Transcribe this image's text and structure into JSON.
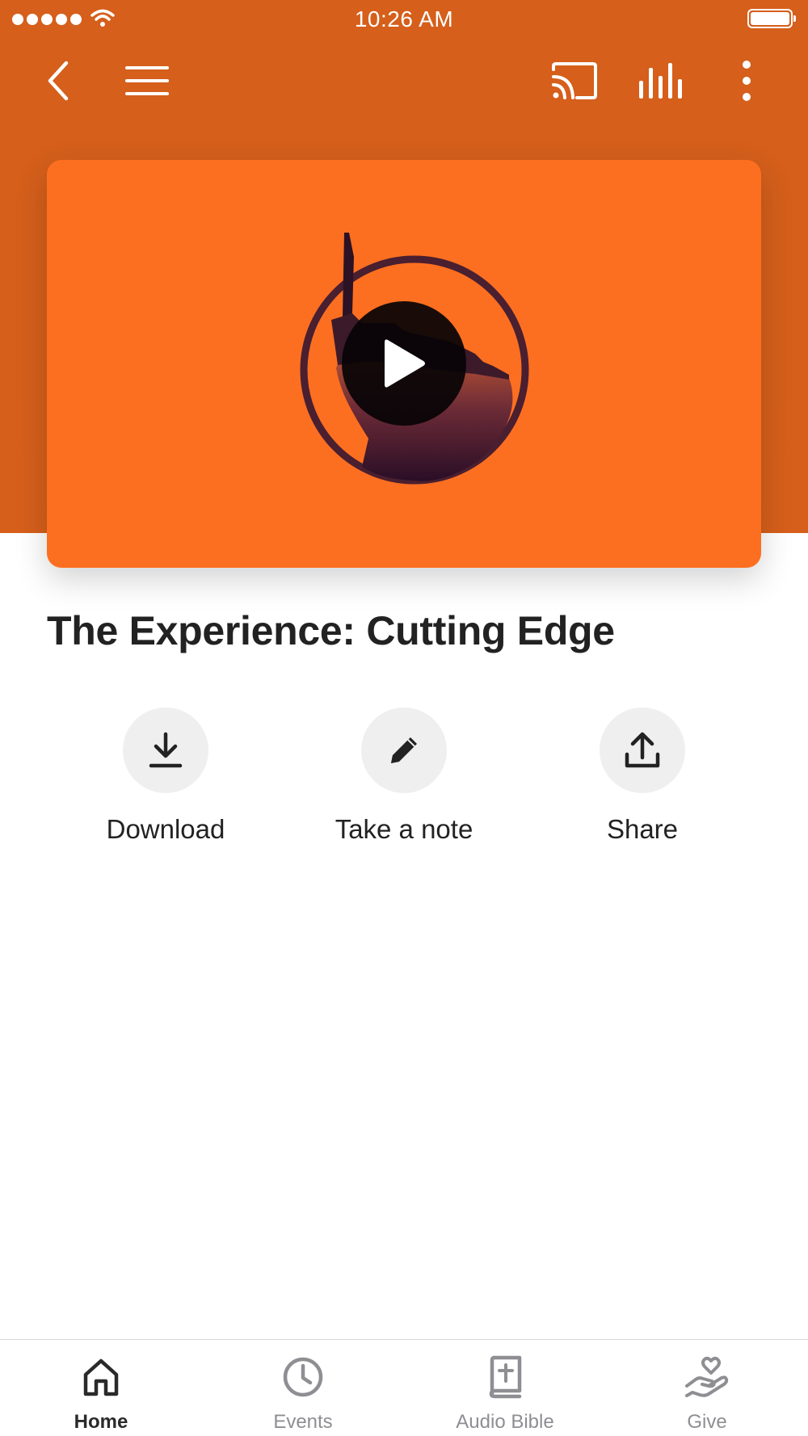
{
  "status_bar": {
    "time": "10:26 AM"
  },
  "toolbar": {
    "icons": [
      "back-icon",
      "menu-icon",
      "cast-icon",
      "equalizer-icon",
      "more-vertical-icon"
    ]
  },
  "media": {
    "title": "The Experience: Cutting Edge",
    "card_color": "#fd6f20",
    "header_color": "#d55f1b"
  },
  "actions": [
    {
      "label": "Download",
      "icon": "download-icon"
    },
    {
      "label": "Take a note",
      "icon": "pencil-icon"
    },
    {
      "label": "Share",
      "icon": "share-icon"
    }
  ],
  "tabs": [
    {
      "label": "Home",
      "icon": "home-icon",
      "active": true
    },
    {
      "label": "Events",
      "icon": "clock-icon",
      "active": false
    },
    {
      "label": "Audio Bible",
      "icon": "bible-icon",
      "active": false
    },
    {
      "label": "Give",
      "icon": "give-icon",
      "active": false
    }
  ]
}
